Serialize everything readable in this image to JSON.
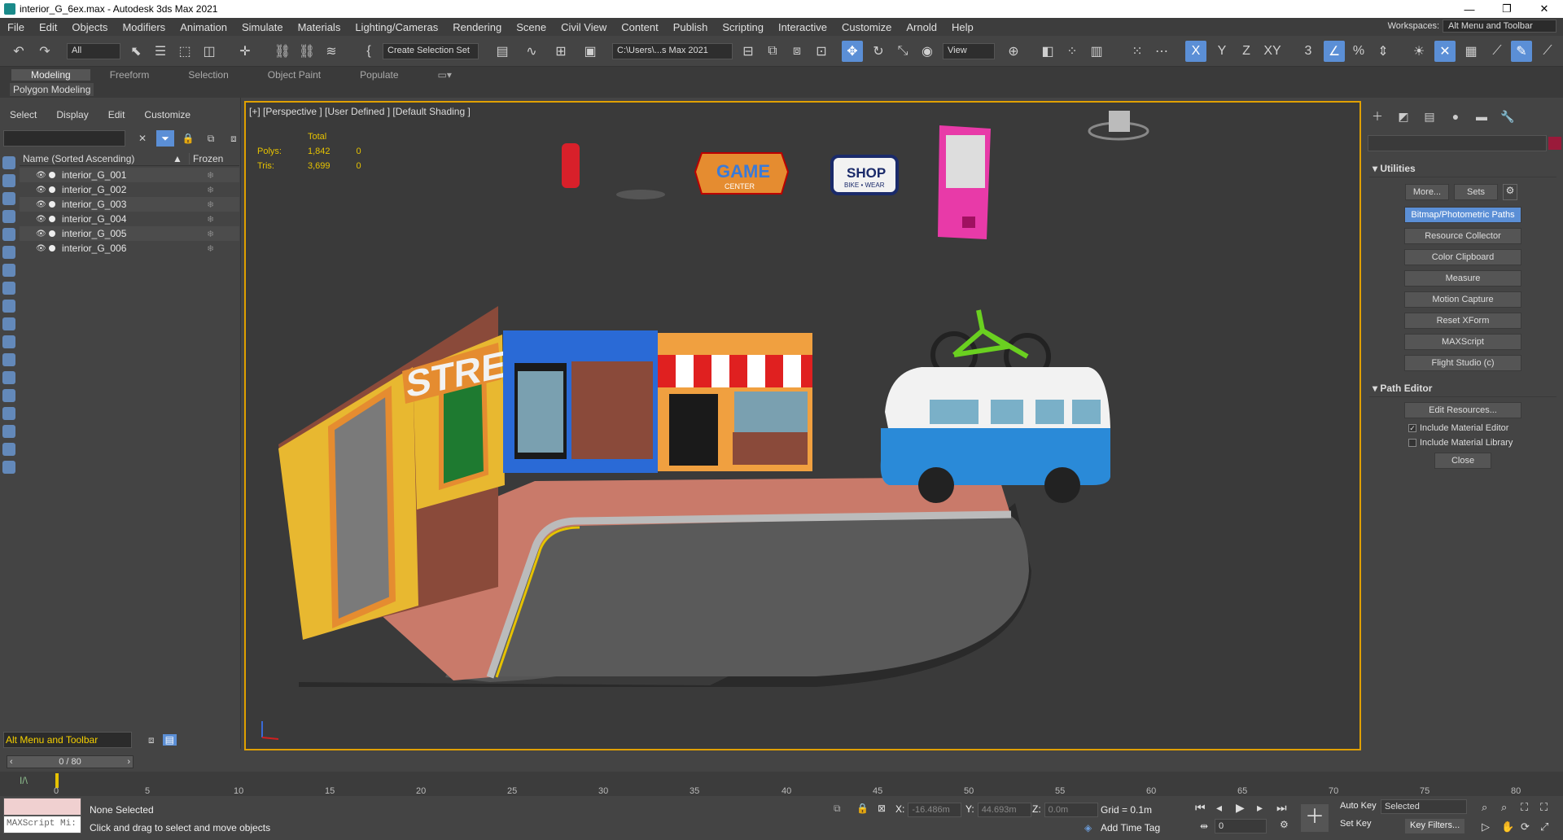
{
  "window": {
    "title": "interior_G_6ex.max - Autodesk 3ds Max 2021",
    "min": "—",
    "max": "❐",
    "close": "✕"
  },
  "menu": [
    "File",
    "Edit",
    "Objects",
    "Modifiers",
    "Animation",
    "Simulate",
    "Materials",
    "Lighting/Cameras",
    "Rendering",
    "Scene",
    "Civil View",
    "Content",
    "Publish",
    "Scripting",
    "Interactive",
    "Customize",
    "Arnold",
    "Help"
  ],
  "workspace": {
    "label": "Workspaces:",
    "value": "Alt Menu and Toolbar"
  },
  "toolbar": {
    "filter": "All",
    "selection_set": "Create Selection Set",
    "project_path": "C:\\Users\\...s Max 2021",
    "ref_coord": "View",
    "axis_x": "X",
    "axis_y": "Y",
    "axis_z": "Z",
    "axis_xy": "XY"
  },
  "ribbon": {
    "tabs": [
      "Modeling",
      "Freeform",
      "Selection",
      "Object Paint",
      "Populate"
    ],
    "sub": "Polygon Modeling"
  },
  "explorer": {
    "menu": [
      "Select",
      "Display",
      "Edit",
      "Customize"
    ],
    "search_placeholder": "",
    "col_name": "Name (Sorted Ascending)",
    "col_sort": "▲",
    "col_frozen": "Frozen",
    "items": [
      "interior_G_001",
      "interior_G_002",
      "interior_G_003",
      "interior_G_004",
      "interior_G_005",
      "interior_G_006"
    ],
    "workspace_box": "Alt Menu and Toolbar"
  },
  "viewport": {
    "label": "[+] [Perspective ] [User Defined ] [Default Shading ]",
    "stats": {
      "header": "Total",
      "polys_label": "Polys:",
      "polys": "1,842",
      "polys_sel": "0",
      "tris_label": "Tris:",
      "tris": "3,699",
      "tris_sel": "0"
    },
    "signs": {
      "street": "STREET",
      "game": "GAME",
      "game_sub": "CENTER",
      "shop": "SHOP",
      "shop_sub": "BIKE • WEAR"
    }
  },
  "command_panel": {
    "utilities_title": "Utilities",
    "more": "More...",
    "sets": "Sets",
    "buttons": [
      "Bitmap/Photometric Paths",
      "Resource Collector",
      "Color Clipboard",
      "Measure",
      "Motion Capture",
      "Reset XForm",
      "MAXScript",
      "Flight Studio (c)"
    ],
    "path_editor_title": "Path Editor",
    "edit_resources": "Edit Resources...",
    "include_mat_editor": "Include Material Editor",
    "include_mat_library": "Include Material Library",
    "close": "Close"
  },
  "timeline": {
    "frame": "0 / 80",
    "ticks": [
      "0",
      "5",
      "10",
      "15",
      "20",
      "25",
      "30",
      "35",
      "40",
      "45",
      "50",
      "55",
      "60",
      "65",
      "70",
      "75",
      "80"
    ]
  },
  "status": {
    "maxscript": "MAXScript Mi:",
    "selected": "None Selected",
    "prompt": "Click and drag to select and move objects",
    "x_label": "X:",
    "x": "-16.486m",
    "y_label": "Y:",
    "y": "44.693m",
    "z_label": "Z:",
    "z": "0.0m",
    "grid": "Grid = 0.1m",
    "add_time_tag": "Add Time Tag",
    "auto_key": "Auto Key",
    "set_key": "Set Key",
    "selected_dd": "Selected",
    "key_filters": "Key Filters...",
    "frame_field": "0"
  },
  "colors": {
    "accent": "#5b8fd6",
    "viewport_border": "#e0a000",
    "stats": "#e6c200"
  }
}
